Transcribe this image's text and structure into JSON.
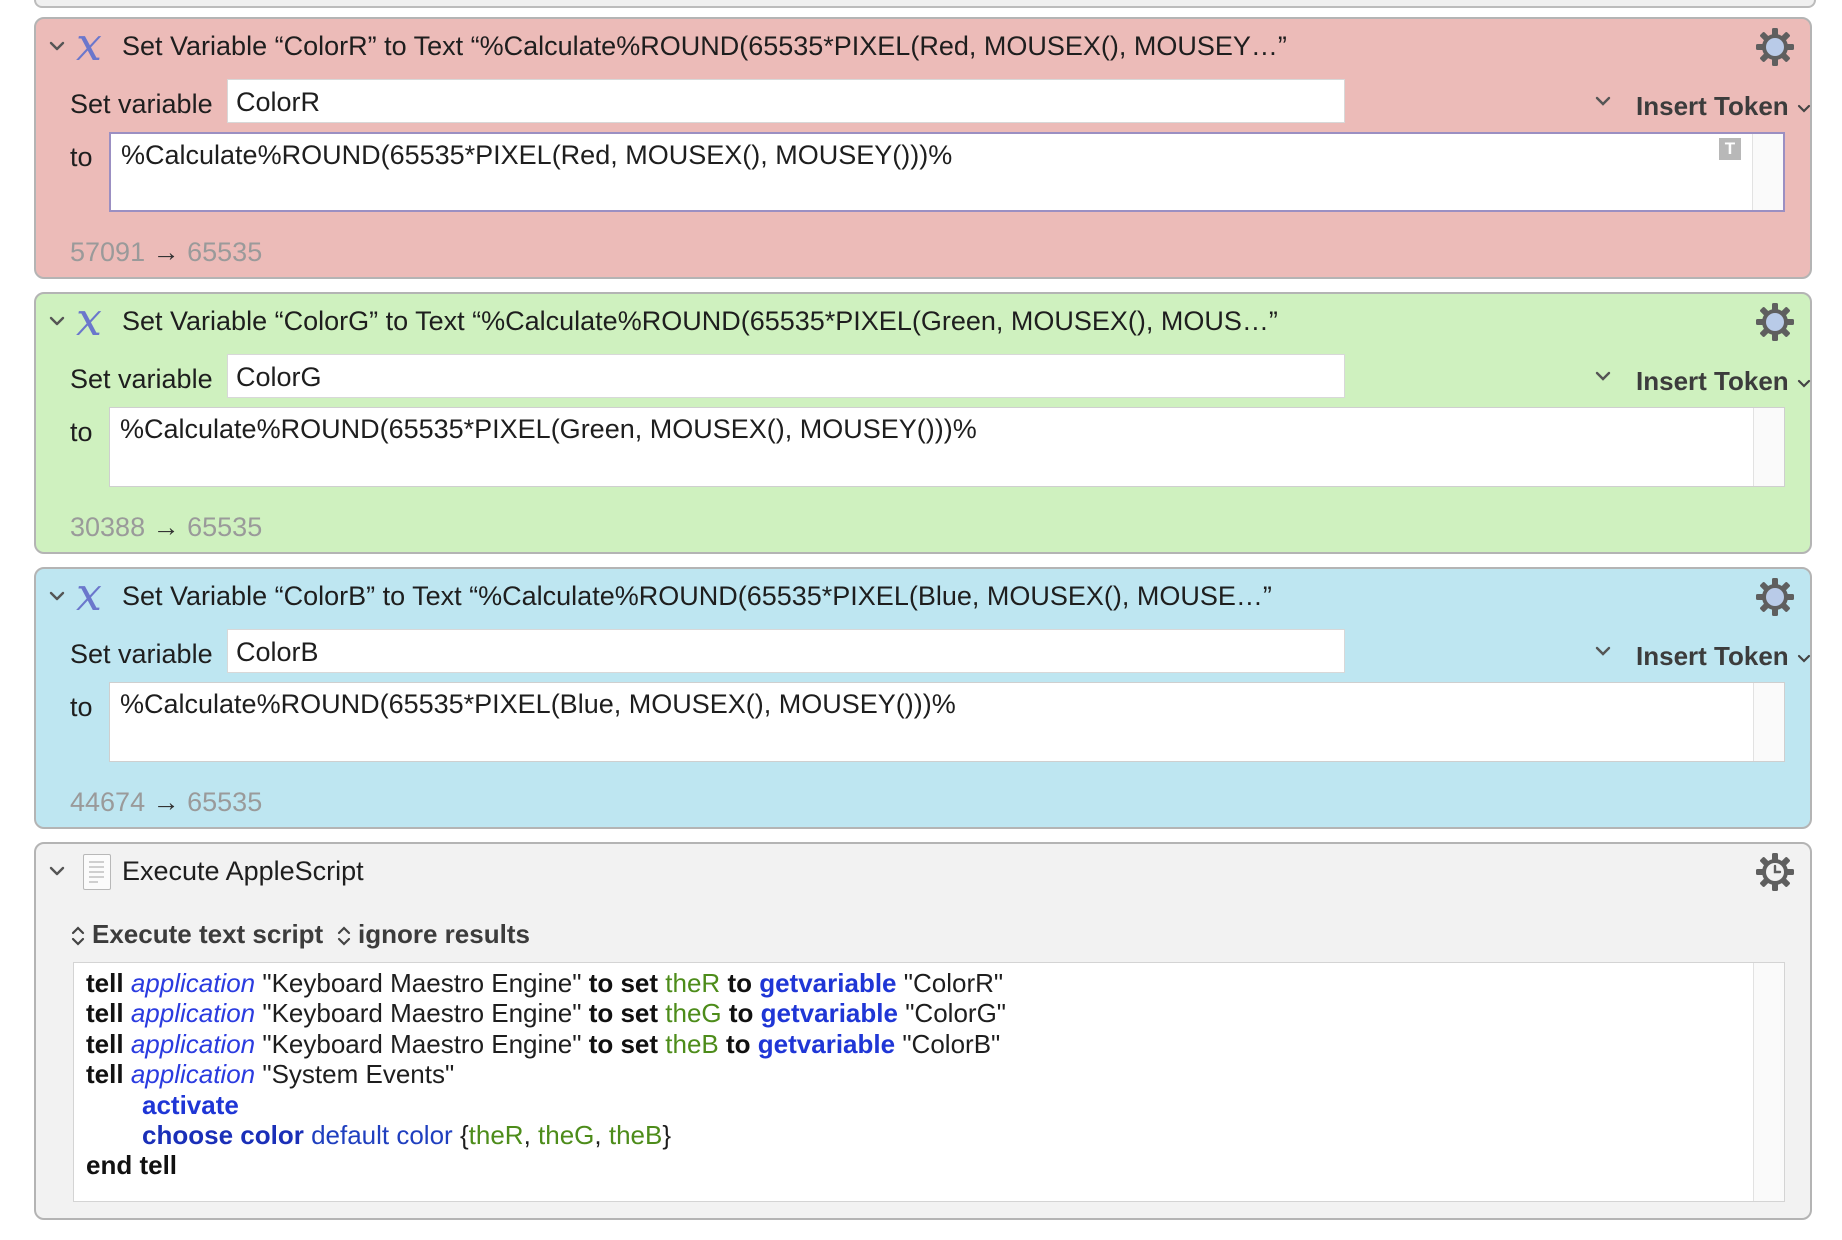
{
  "actions": [
    {
      "color": "#ecbbb8",
      "header": "Set Variable “ColorR” to Text “%Calculate%ROUND(65535*PIXEL(Red, MOUSEX(), MOUSEY…”",
      "set_label": "Set variable",
      "variable": "ColorR",
      "insert_token": "Insert Token",
      "to_label": "to",
      "text": "%Calculate%ROUND(65535*PIXEL(Red, MOUSEX(), MOUSEY()))%",
      "text_badge": "T",
      "result_from": "57091",
      "result_arrow": "→",
      "result_to": "65535"
    },
    {
      "color": "#cff1bf",
      "header": "Set Variable “ColorG” to Text “%Calculate%ROUND(65535*PIXEL(Green, MOUSEX(), MOUS…”",
      "set_label": "Set variable",
      "variable": "ColorG",
      "insert_token": "Insert Token",
      "to_label": "to",
      "text": "%Calculate%ROUND(65535*PIXEL(Green, MOUSEX(), MOUSEY()))%",
      "result_from": "30388",
      "result_arrow": "→",
      "result_to": "65535"
    },
    {
      "color": "#bee6f1",
      "header": "Set Variable “ColorB” to Text “%Calculate%ROUND(65535*PIXEL(Blue, MOUSEX(), MOUSE…”",
      "set_label": "Set variable",
      "variable": "ColorB",
      "insert_token": "Insert Token",
      "to_label": "to",
      "text": "%Calculate%ROUND(65535*PIXEL(Blue, MOUSEX(), MOUSEY()))%",
      "result_from": "44674",
      "result_arrow": "→",
      "result_to": "65535"
    }
  ],
  "applescript": {
    "header": "Execute AppleScript",
    "option_execute": "Execute text script",
    "option_results": "ignore results",
    "tokens": {
      "tell": "tell",
      "application": "application",
      "km_engine": "\"Keyboard Maestro Engine\"",
      "to": "to",
      "set": "set",
      "theR": "theR",
      "theG": "theG",
      "theB": "theB",
      "getvariable": "getvariable",
      "colorR": "\"ColorR\"",
      "colorG": "\"ColorG\"",
      "colorB": "\"ColorB\"",
      "system_events": "\"System Events\"",
      "activate": "activate",
      "choose_color": "choose color",
      "default_color": "default color",
      "open_brace": "{",
      "comma": ",",
      "close_brace": "}",
      "end_tell": "end tell"
    }
  },
  "icons": {
    "action_icon": "variable-x-icon",
    "script_icon": "script-document-icon",
    "gear": "gear-icon",
    "gear_timer": "gear-clock-icon",
    "disclosure": "chevron-down-icon"
  }
}
